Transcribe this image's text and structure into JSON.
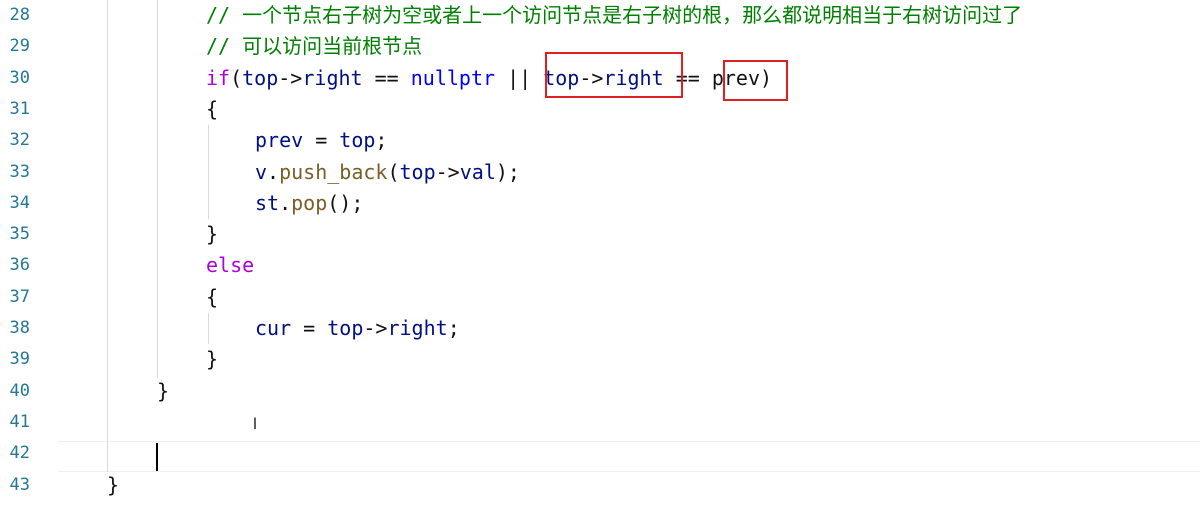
{
  "editor": {
    "lines": [
      {
        "num": "28",
        "tokens": [
          {
            "t": "// 一个节点右子树为空或者上一个访问节点是右子树的根，那么都说明相当于右树访问过了",
            "c": "comment"
          }
        ]
      },
      {
        "num": "29",
        "tokens": [
          {
            "t": "// 可以访问当前根节点",
            "c": "comment"
          }
        ]
      },
      {
        "num": "30",
        "tokens": [
          {
            "t": "if",
            "c": "keyword"
          },
          {
            "t": "(",
            "c": "punct"
          },
          {
            "t": "top",
            "c": "ident"
          },
          {
            "t": "->",
            "c": "op"
          },
          {
            "t": "right",
            "c": "ident"
          },
          {
            "t": " == ",
            "c": "op"
          },
          {
            "t": "nullptr",
            "c": "nullptr"
          },
          {
            "t": " || ",
            "c": "op"
          },
          {
            "t": "top",
            "c": "ident"
          },
          {
            "t": "->",
            "c": "op"
          },
          {
            "t": "right",
            "c": "ident"
          },
          {
            "t": " == ",
            "c": "op"
          },
          {
            "t": "prev",
            "c": "ident2"
          },
          {
            "t": ")",
            "c": "punct"
          }
        ]
      },
      {
        "num": "31",
        "tokens": [
          {
            "t": "{",
            "c": "punct"
          }
        ]
      },
      {
        "num": "32",
        "tokens": [
          {
            "t": "prev",
            "c": "ident"
          },
          {
            "t": " = ",
            "c": "op"
          },
          {
            "t": "top",
            "c": "ident"
          },
          {
            "t": ";",
            "c": "punct"
          }
        ]
      },
      {
        "num": "33",
        "tokens": [
          {
            "t": "v",
            "c": "ident"
          },
          {
            "t": ".",
            "c": "punct"
          },
          {
            "t": "push_back",
            "c": "func"
          },
          {
            "t": "(",
            "c": "punct"
          },
          {
            "t": "top",
            "c": "ident"
          },
          {
            "t": "->",
            "c": "op"
          },
          {
            "t": "val",
            "c": "ident"
          },
          {
            "t": ");",
            "c": "punct"
          }
        ]
      },
      {
        "num": "34",
        "tokens": [
          {
            "t": "st",
            "c": "ident"
          },
          {
            "t": ".",
            "c": "punct"
          },
          {
            "t": "pop",
            "c": "func"
          },
          {
            "t": "();",
            "c": "punct"
          }
        ]
      },
      {
        "num": "35",
        "tokens": [
          {
            "t": "}",
            "c": "punct"
          }
        ]
      },
      {
        "num": "36",
        "tokens": [
          {
            "t": "else",
            "c": "keyword"
          }
        ]
      },
      {
        "num": "37",
        "tokens": [
          {
            "t": "{",
            "c": "punct"
          }
        ]
      },
      {
        "num": "38",
        "tokens": [
          {
            "t": "cur",
            "c": "ident"
          },
          {
            "t": " = ",
            "c": "op"
          },
          {
            "t": "top",
            "c": "ident"
          },
          {
            "t": "->",
            "c": "op"
          },
          {
            "t": "right",
            "c": "ident"
          },
          {
            "t": ";",
            "c": "punct"
          }
        ]
      },
      {
        "num": "39",
        "tokens": [
          {
            "t": "}",
            "c": "punct"
          }
        ]
      },
      {
        "num": "40",
        "tokens": [
          {
            "t": "}",
            "c": "punct"
          }
        ]
      },
      {
        "num": "41",
        "tokens": []
      },
      {
        "num": "42",
        "tokens": []
      },
      {
        "num": "43",
        "tokens": [
          {
            "t": "}",
            "c": "punct"
          }
        ]
      }
    ]
  },
  "colors": {
    "comment": "#008000",
    "keyword": "#af00db",
    "identifier": "#001080",
    "function": "#795e26",
    "nullptr": "#0000ff",
    "line_number": "#237893",
    "highlight_box": "#e02020"
  },
  "icons": {
    "ibeam": "text-cursor-icon"
  }
}
